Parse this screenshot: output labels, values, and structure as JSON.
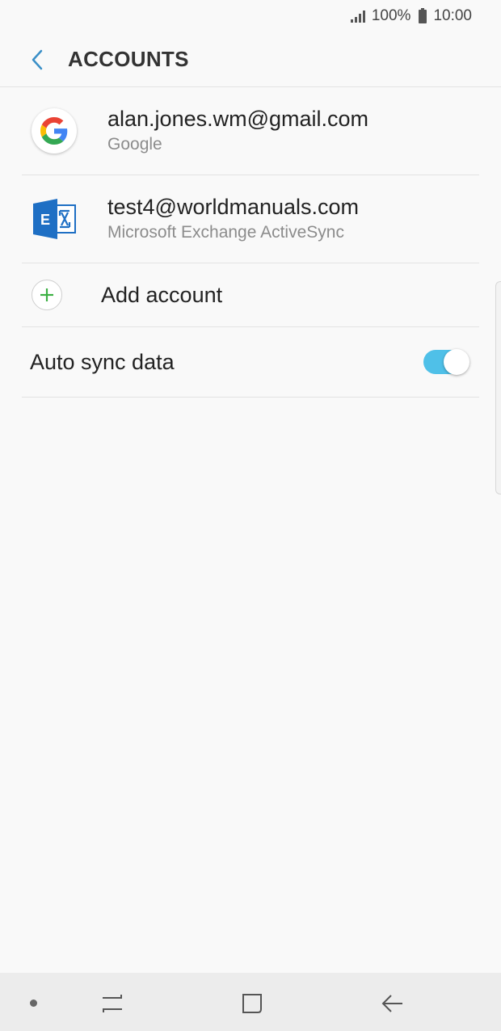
{
  "status_bar": {
    "battery_percent": "100%",
    "time": "10:00"
  },
  "header": {
    "title": "ACCOUNTS",
    "back_icon": "chevron-left-icon"
  },
  "accounts": [
    {
      "email": "alan.jones.wm@gmail.com",
      "type": "Google",
      "icon": "google-icon"
    },
    {
      "email": "test4@worldmanuals.com",
      "type": "Microsoft Exchange ActiveSync",
      "icon": "exchange-icon"
    }
  ],
  "add_account": {
    "label": "Add account",
    "icon": "plus-icon"
  },
  "auto_sync": {
    "label": "Auto sync data",
    "enabled": true
  },
  "colors": {
    "accent": "#4fc0e8",
    "back_arrow": "#3a8fc7",
    "add_icon": "#3cb043",
    "exchange_blue": "#1e6fc4"
  },
  "nav_bar": {
    "recent_icon": "recent-apps-icon",
    "home_icon": "home-icon",
    "back_icon": "back-arrow-icon"
  }
}
